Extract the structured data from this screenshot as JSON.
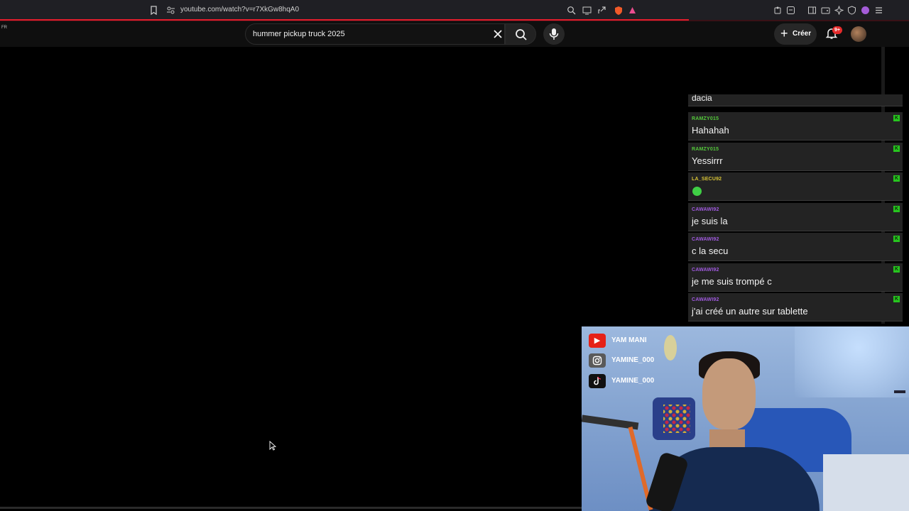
{
  "browser": {
    "url": "youtube.com/watch?v=r7XkGw8hqA0"
  },
  "header": {
    "region_label": "FR",
    "search_value": "hummer pickup truck 2025",
    "create_label": "Créer",
    "notification_badge": "9+"
  },
  "chat": {
    "partial_top_message": "dacia",
    "messages": [
      {
        "user": "RAMZY015",
        "text": "Hahahah",
        "color": "#53c83a"
      },
      {
        "user": "RAMZY015",
        "text": "Yessirrr",
        "color": "#53c83a"
      },
      {
        "user": "LA_SECU92",
        "text": "",
        "emoji": "whatsapp-green-icon",
        "color": "#d8c335"
      },
      {
        "user": "CAWAWI92",
        "text": "je suis la",
        "color": "#a05adf"
      },
      {
        "user": "CAWAWI92",
        "text": "c la secu",
        "color": "#a05adf"
      },
      {
        "user": "CAWAWI92",
        "text": "je me suis trompé c",
        "color": "#a05adf"
      },
      {
        "user": "CAWAWI92",
        "text": "j'ai créé un autre sur tablette",
        "color": "#a05adf"
      }
    ]
  },
  "webcam": {
    "socials": [
      {
        "icon": "youtube-icon",
        "label": "YAM MANI",
        "color": "#e62117"
      },
      {
        "icon": "instagram-icon",
        "label": "YAMINE_000",
        "color": "#6b6b6b"
      },
      {
        "icon": "tiktok-icon",
        "label": "YAMINE_000",
        "color": "#111111"
      }
    ]
  }
}
